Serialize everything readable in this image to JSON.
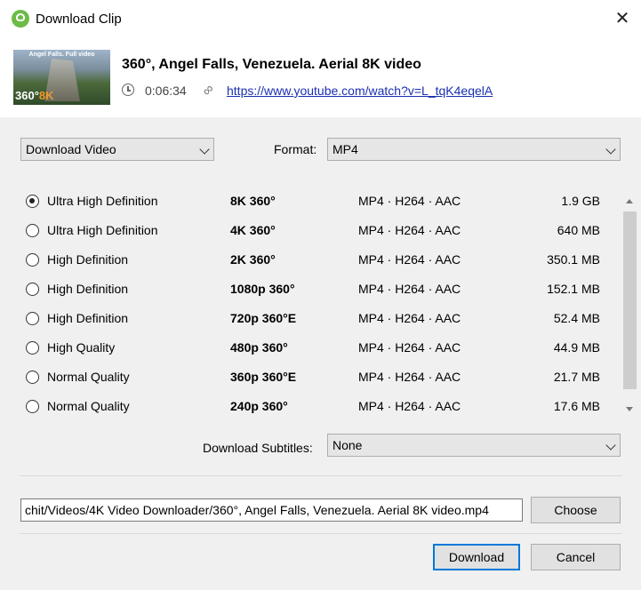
{
  "window": {
    "title": "Download Clip",
    "close_glyph": "✕"
  },
  "video": {
    "title": "360°, Angel Falls, Venezuela. Aerial 8K video",
    "duration": "0:06:34",
    "url": "https://www.youtube.com/watch?v=L_tqK4eqelA",
    "thumbnail": {
      "caption": "Angel Falls. Full video",
      "badge_360": "360°",
      "badge_8k": "8K"
    }
  },
  "controls": {
    "mode_select": "Download Video",
    "format_label": "Format:",
    "format_value": "MP4",
    "subtitles_label": "Download Subtitles:",
    "subtitles_value": "None"
  },
  "options": [
    {
      "quality": "Ultra High Definition",
      "resolution": "8K 360°",
      "codec": "MP4 · H264 · AAC",
      "size": "1.9 GB",
      "selected": true
    },
    {
      "quality": "Ultra High Definition",
      "resolution": "4K 360°",
      "codec": "MP4 · H264 · AAC",
      "size": "640 MB",
      "selected": false
    },
    {
      "quality": "High Definition",
      "resolution": "2K 360°",
      "codec": "MP4 · H264 · AAC",
      "size": "350.1 MB",
      "selected": false
    },
    {
      "quality": "High Definition",
      "resolution": "1080p 360°",
      "codec": "MP4 · H264 · AAC",
      "size": "152.1 MB",
      "selected": false
    },
    {
      "quality": "High Definition",
      "resolution": "720p 360°E",
      "codec": "MP4 · H264 · AAC",
      "size": "52.4 MB",
      "selected": false
    },
    {
      "quality": "High Quality",
      "resolution": "480p 360°",
      "codec": "MP4 · H264 · AAC",
      "size": "44.9 MB",
      "selected": false
    },
    {
      "quality": "Normal Quality",
      "resolution": "360p 360°E",
      "codec": "MP4 · H264 · AAC",
      "size": "21.7 MB",
      "selected": false
    },
    {
      "quality": "Normal Quality",
      "resolution": "240p 360°",
      "codec": "MP4 · H264 · AAC",
      "size": "17.6 MB",
      "selected": false
    }
  ],
  "save_path": "chit/Videos/4K Video Downloader/360°, Angel Falls, Venezuela. Aerial 8K video.mp4",
  "buttons": {
    "choose": "Choose",
    "download": "Download",
    "cancel": "Cancel"
  }
}
